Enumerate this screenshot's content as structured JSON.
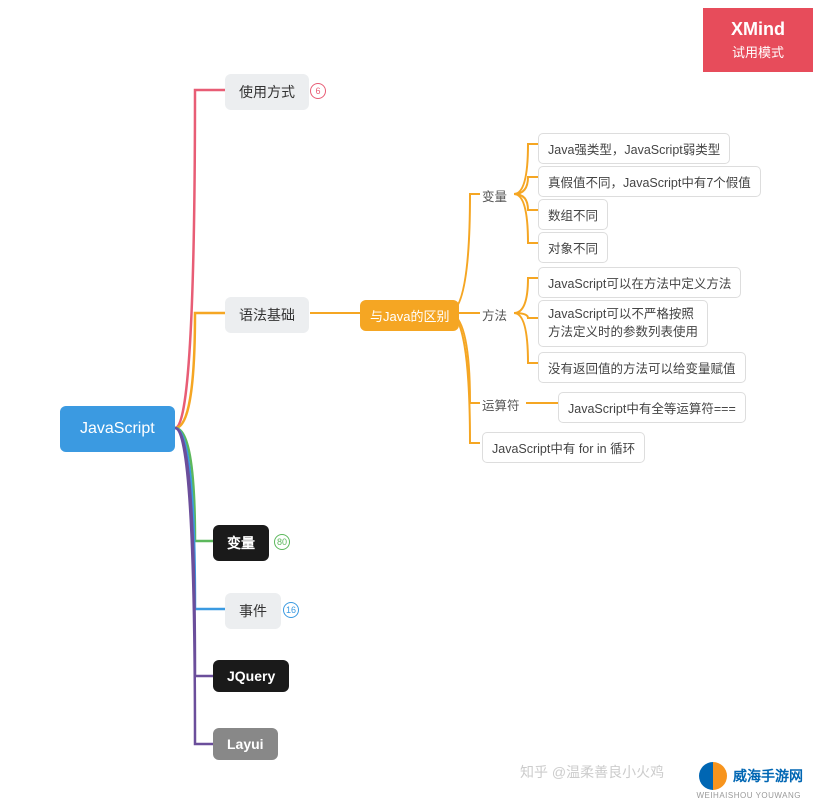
{
  "root": {
    "label": "JavaScript"
  },
  "level1": [
    {
      "label": "使用方式",
      "badge": "6"
    },
    {
      "label": "语法基础"
    },
    {
      "label": "变量",
      "badge": "80"
    },
    {
      "label": "事件",
      "badge": "16"
    },
    {
      "label": "JQuery"
    },
    {
      "label": "Layui"
    }
  ],
  "level2": {
    "label": "与Java的区别"
  },
  "level3": [
    {
      "label": "变量"
    },
    {
      "label": "方法"
    },
    {
      "label": "运算符"
    }
  ],
  "leaves": {
    "variable": [
      "Java强类型，JavaScript弱类型",
      "真假值不同，JavaScript中有7个假值",
      "数组不同",
      "对象不同"
    ],
    "method": [
      "JavaScript可以在方法中定义方法",
      "JavaScript可以不严格按照\n方法定义时的参数列表使用",
      "没有返回值的方法可以给变量赋值"
    ],
    "operator": [
      "JavaScript中有全等运算符==="
    ],
    "forin": "JavaScript中有 for in 循环"
  },
  "watermark": {
    "title": "XMind",
    "sub": "试用模式"
  },
  "zhihu": "知乎 @温柔善良小火鸡",
  "footer": {
    "text": "威海手游网",
    "sub": "WEIHAISHOU YOUWANG"
  },
  "colors": {
    "root": "#3b9ae1",
    "branch_usage": "#e85d75",
    "branch_syntax": "#f5a623",
    "branch_variable": "#5cb85c",
    "branch_event": "#3b9ae1",
    "branch_jquery": "#6b4e9b",
    "branch_layui": "#6b4e9b",
    "watermark": "#e74c5b"
  }
}
